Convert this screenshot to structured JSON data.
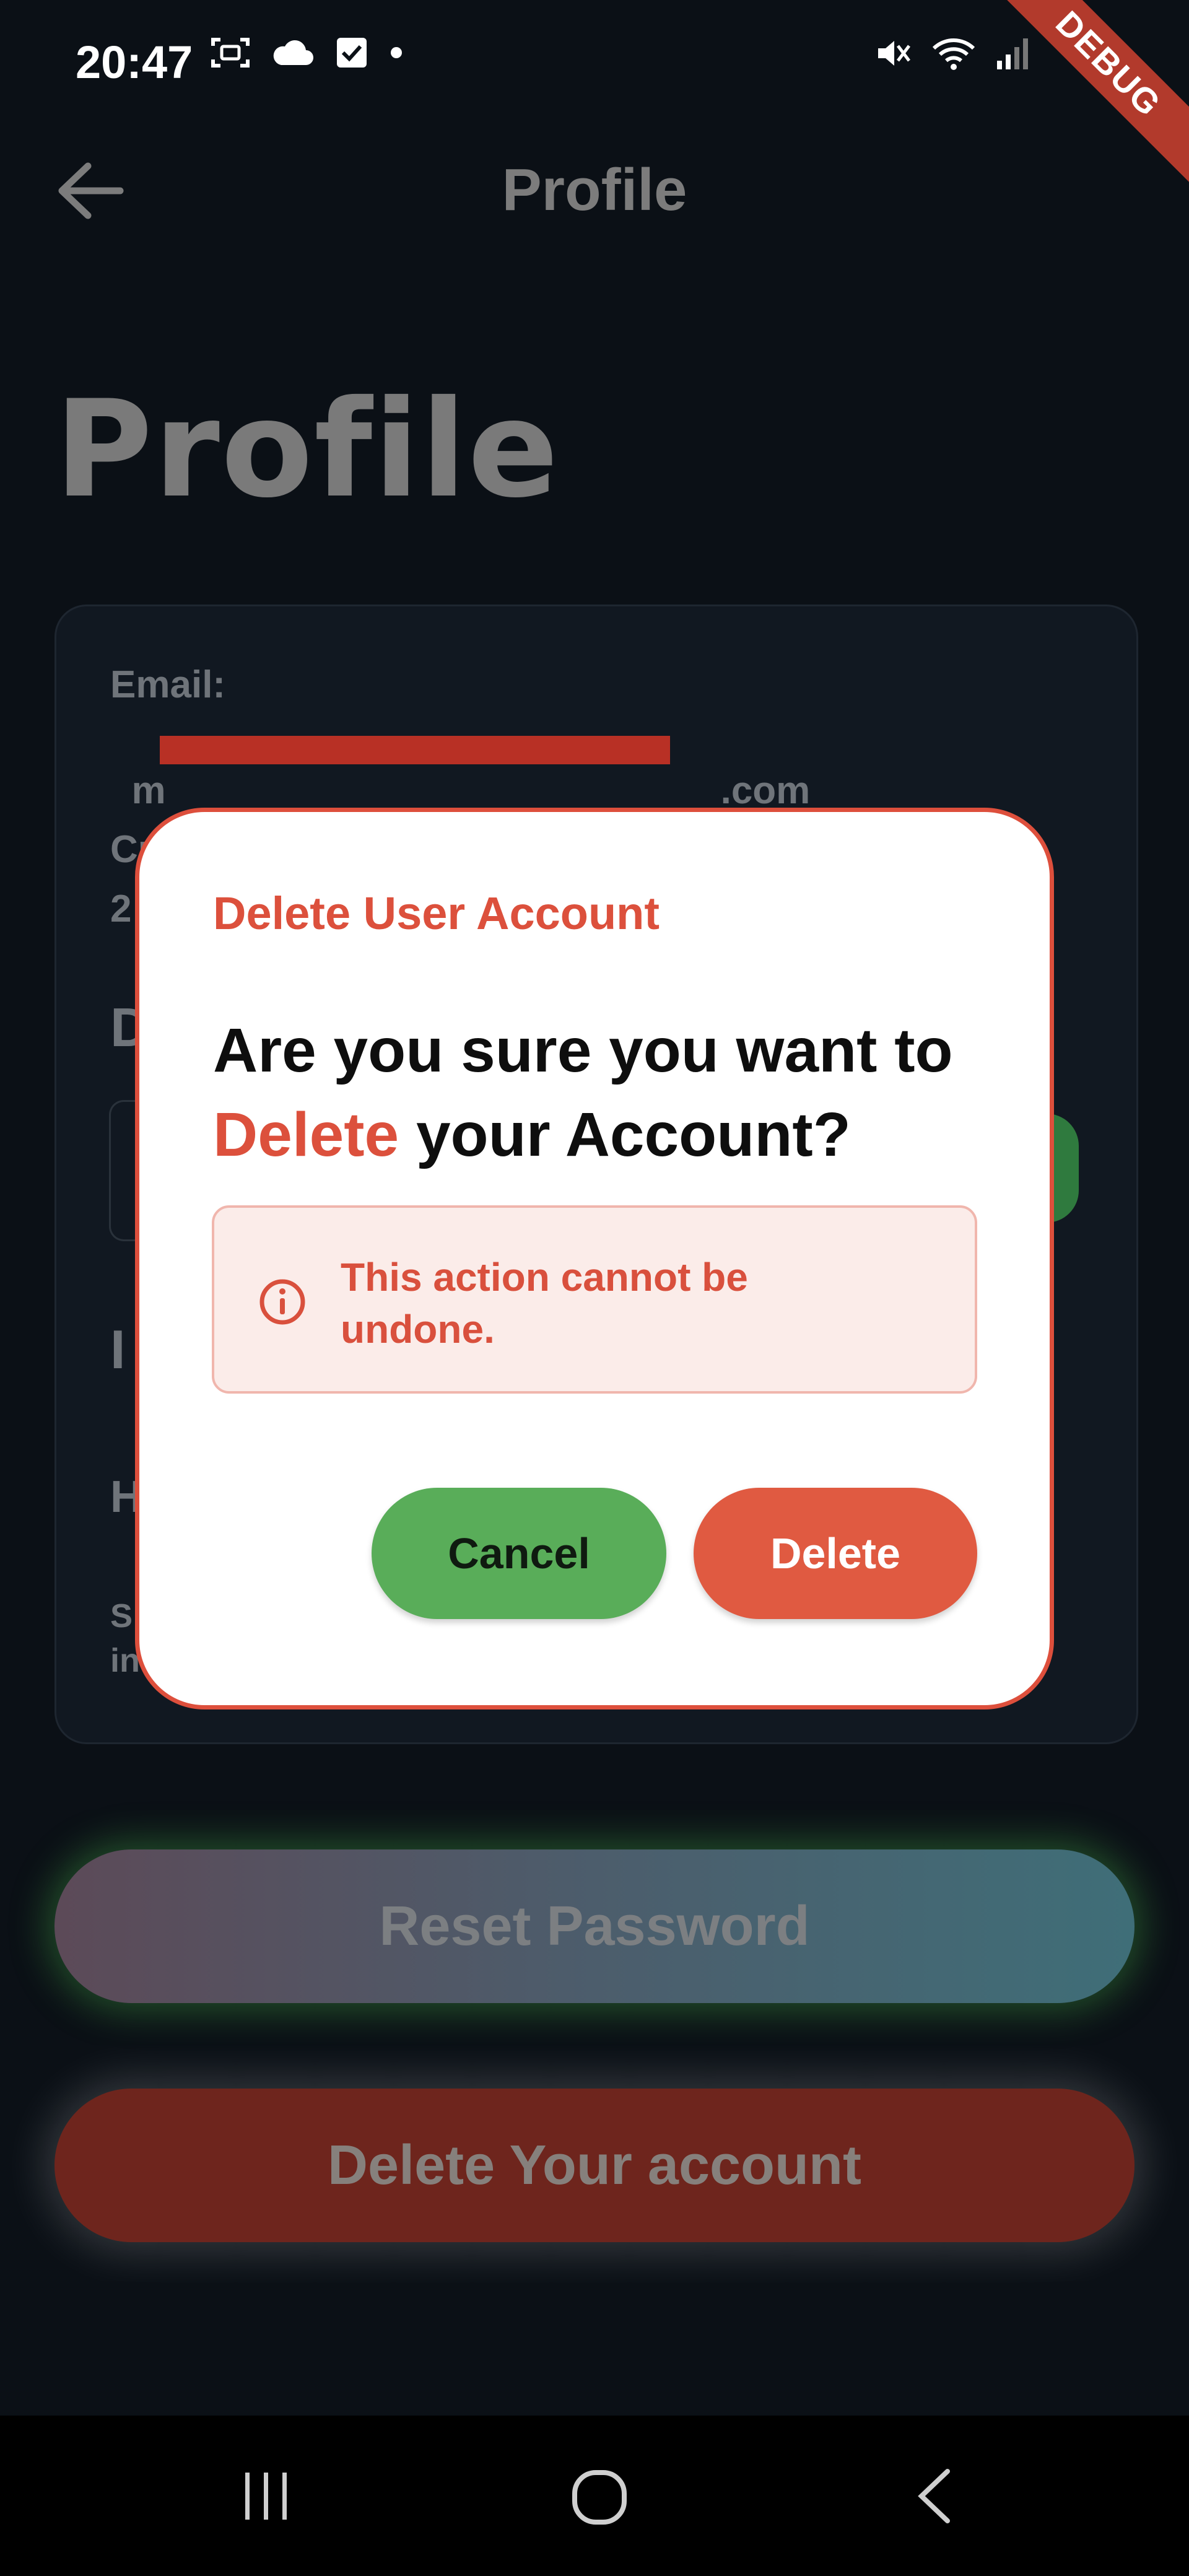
{
  "status_bar": {
    "time": "20:47",
    "left_icons": [
      "screenshot-icon",
      "cloud-icon",
      "checkbox-icon",
      "dot-icon"
    ],
    "right_icons": [
      "mute-icon",
      "wifi-icon",
      "signal-icon"
    ],
    "debug_banner": "DEBUG"
  },
  "app_bar": {
    "back_icon": "back-arrow-icon",
    "title": "Profile"
  },
  "page": {
    "heading": "Profile"
  },
  "profile_card": {
    "email_label": "Email:",
    "email_value_visible_suffix": ".com",
    "email_value_prefix": "m",
    "partial_labels": {
      "created_first": "Cr",
      "created_value_first": "2",
      "section_d": "D",
      "section_i": "I",
      "section_h": "H",
      "footer_line1": "S",
      "footer_line2": "in"
    }
  },
  "buttons": {
    "reset_password": "Reset Password",
    "delete_account": "Delete Your account"
  },
  "dialog": {
    "title": "Delete User Account",
    "question_part1": "Are you sure you want to",
    "question_highlight": "Delete",
    "question_part2": " your Account?",
    "warning_icon": "info-icon",
    "warning_text": "This action cannot be undone.",
    "cancel_label": "Cancel",
    "delete_label": "Delete"
  },
  "colors": {
    "accent_red": "#dc503c",
    "cancel_green": "#59ad59",
    "delete_red": "#e05a41",
    "background": "#0b1016"
  },
  "nav_bar": {
    "icons": [
      "recent-apps-icon",
      "home-icon",
      "back-icon"
    ]
  }
}
